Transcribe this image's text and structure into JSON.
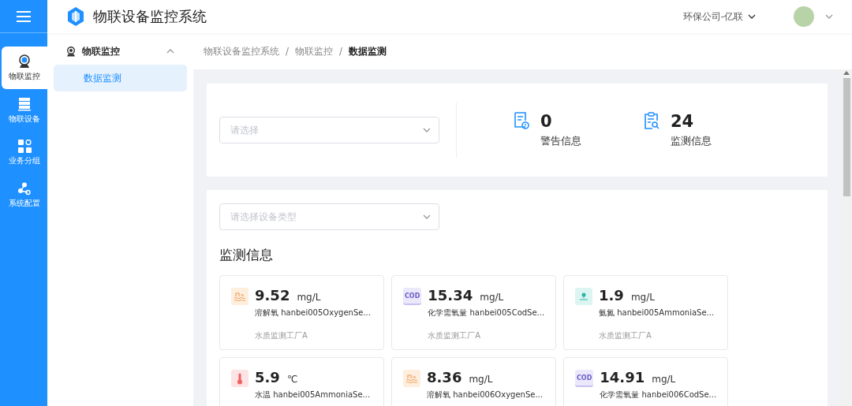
{
  "header": {
    "title": "物联设备监控系统",
    "company": "环保公司-亿联"
  },
  "rail": [
    {
      "label": "物联监控",
      "kind": "monitor",
      "selected": true
    },
    {
      "label": "物联设备",
      "kind": "server",
      "selected": false
    },
    {
      "label": "业务分组",
      "kind": "grid",
      "selected": false
    },
    {
      "label": "系统配置",
      "kind": "share",
      "selected": false
    }
  ],
  "submenu": {
    "title": "物联监控",
    "expanded": true,
    "items": [
      {
        "label": "数据监测",
        "selected": true
      }
    ]
  },
  "breadcrumb": {
    "separator": "/",
    "items": [
      "物联设备监控系统",
      "物联监控",
      "数据监测"
    ]
  },
  "summary": {
    "select": {
      "placeholder": "请选择"
    },
    "stats": [
      {
        "kind": "warning",
        "value": "0",
        "label": "警告信息"
      },
      {
        "kind": "monitor",
        "value": "24",
        "label": "监测信息"
      }
    ]
  },
  "monitor": {
    "select": {
      "placeholder": "请选择设备类型"
    },
    "title": "监测信息",
    "cards": [
      {
        "kind": "oxygen",
        "value": "9.52",
        "unit": "mg/L",
        "name": "溶解氧 hanbei005OxygenSe...",
        "site": "水质监测工厂A"
      },
      {
        "kind": "cod",
        "icon_text": "COD",
        "value": "15.34",
        "unit": "mg/L",
        "name": "化学需氧量 hanbei005CodSe...",
        "site": "水质监测工厂A"
      },
      {
        "kind": "ammonia",
        "value": "1.9",
        "unit": "mg/L",
        "name": "氨氮 hanbei005AmmoniaSe...",
        "site": "水质监测工厂A"
      },
      {
        "kind": "temperature",
        "value": "5.9",
        "unit": "℃",
        "name": "水温 hanbei005AmmoniaSe..."
      },
      {
        "kind": "oxygen",
        "value": "8.36",
        "unit": "mg/L",
        "name": "溶解氧 hanbei006OxygenSe..."
      },
      {
        "kind": "cod",
        "icon_text": "COD",
        "value": "14.91",
        "unit": "mg/L",
        "name": "化学需氧量 hanbei006CodSe..."
      }
    ]
  }
}
